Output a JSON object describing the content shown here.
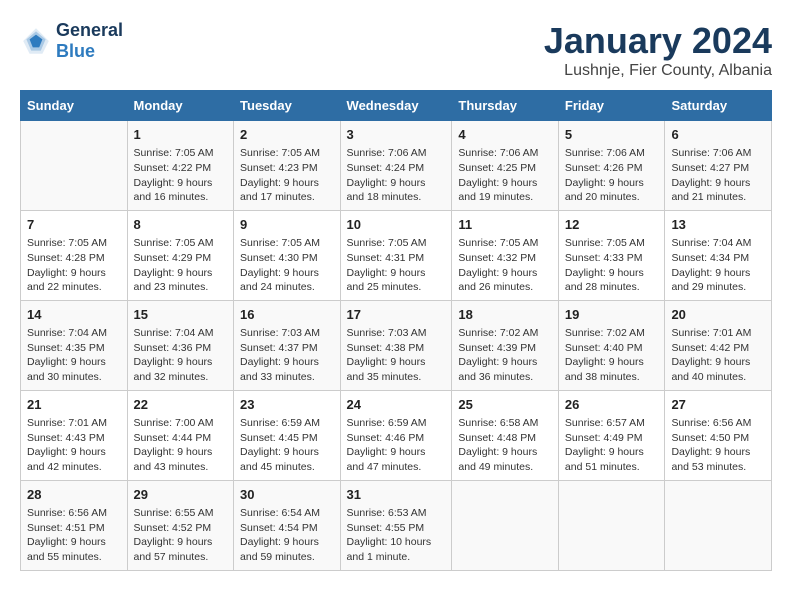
{
  "header": {
    "logo_line1": "General",
    "logo_line2": "Blue",
    "month": "January 2024",
    "location": "Lushnje, Fier County, Albania"
  },
  "columns": [
    "Sunday",
    "Monday",
    "Tuesday",
    "Wednesday",
    "Thursday",
    "Friday",
    "Saturday"
  ],
  "weeks": [
    [
      {
        "day": "",
        "info": ""
      },
      {
        "day": "1",
        "info": "Sunrise: 7:05 AM\nSunset: 4:22 PM\nDaylight: 9 hours\nand 16 minutes."
      },
      {
        "day": "2",
        "info": "Sunrise: 7:05 AM\nSunset: 4:23 PM\nDaylight: 9 hours\nand 17 minutes."
      },
      {
        "day": "3",
        "info": "Sunrise: 7:06 AM\nSunset: 4:24 PM\nDaylight: 9 hours\nand 18 minutes."
      },
      {
        "day": "4",
        "info": "Sunrise: 7:06 AM\nSunset: 4:25 PM\nDaylight: 9 hours\nand 19 minutes."
      },
      {
        "day": "5",
        "info": "Sunrise: 7:06 AM\nSunset: 4:26 PM\nDaylight: 9 hours\nand 20 minutes."
      },
      {
        "day": "6",
        "info": "Sunrise: 7:06 AM\nSunset: 4:27 PM\nDaylight: 9 hours\nand 21 minutes."
      }
    ],
    [
      {
        "day": "7",
        "info": "Sunrise: 7:05 AM\nSunset: 4:28 PM\nDaylight: 9 hours\nand 22 minutes."
      },
      {
        "day": "8",
        "info": "Sunrise: 7:05 AM\nSunset: 4:29 PM\nDaylight: 9 hours\nand 23 minutes."
      },
      {
        "day": "9",
        "info": "Sunrise: 7:05 AM\nSunset: 4:30 PM\nDaylight: 9 hours\nand 24 minutes."
      },
      {
        "day": "10",
        "info": "Sunrise: 7:05 AM\nSunset: 4:31 PM\nDaylight: 9 hours\nand 25 minutes."
      },
      {
        "day": "11",
        "info": "Sunrise: 7:05 AM\nSunset: 4:32 PM\nDaylight: 9 hours\nand 26 minutes."
      },
      {
        "day": "12",
        "info": "Sunrise: 7:05 AM\nSunset: 4:33 PM\nDaylight: 9 hours\nand 28 minutes."
      },
      {
        "day": "13",
        "info": "Sunrise: 7:04 AM\nSunset: 4:34 PM\nDaylight: 9 hours\nand 29 minutes."
      }
    ],
    [
      {
        "day": "14",
        "info": "Sunrise: 7:04 AM\nSunset: 4:35 PM\nDaylight: 9 hours\nand 30 minutes."
      },
      {
        "day": "15",
        "info": "Sunrise: 7:04 AM\nSunset: 4:36 PM\nDaylight: 9 hours\nand 32 minutes."
      },
      {
        "day": "16",
        "info": "Sunrise: 7:03 AM\nSunset: 4:37 PM\nDaylight: 9 hours\nand 33 minutes."
      },
      {
        "day": "17",
        "info": "Sunrise: 7:03 AM\nSunset: 4:38 PM\nDaylight: 9 hours\nand 35 minutes."
      },
      {
        "day": "18",
        "info": "Sunrise: 7:02 AM\nSunset: 4:39 PM\nDaylight: 9 hours\nand 36 minutes."
      },
      {
        "day": "19",
        "info": "Sunrise: 7:02 AM\nSunset: 4:40 PM\nDaylight: 9 hours\nand 38 minutes."
      },
      {
        "day": "20",
        "info": "Sunrise: 7:01 AM\nSunset: 4:42 PM\nDaylight: 9 hours\nand 40 minutes."
      }
    ],
    [
      {
        "day": "21",
        "info": "Sunrise: 7:01 AM\nSunset: 4:43 PM\nDaylight: 9 hours\nand 42 minutes."
      },
      {
        "day": "22",
        "info": "Sunrise: 7:00 AM\nSunset: 4:44 PM\nDaylight: 9 hours\nand 43 minutes."
      },
      {
        "day": "23",
        "info": "Sunrise: 6:59 AM\nSunset: 4:45 PM\nDaylight: 9 hours\nand 45 minutes."
      },
      {
        "day": "24",
        "info": "Sunrise: 6:59 AM\nSunset: 4:46 PM\nDaylight: 9 hours\nand 47 minutes."
      },
      {
        "day": "25",
        "info": "Sunrise: 6:58 AM\nSunset: 4:48 PM\nDaylight: 9 hours\nand 49 minutes."
      },
      {
        "day": "26",
        "info": "Sunrise: 6:57 AM\nSunset: 4:49 PM\nDaylight: 9 hours\nand 51 minutes."
      },
      {
        "day": "27",
        "info": "Sunrise: 6:56 AM\nSunset: 4:50 PM\nDaylight: 9 hours\nand 53 minutes."
      }
    ],
    [
      {
        "day": "28",
        "info": "Sunrise: 6:56 AM\nSunset: 4:51 PM\nDaylight: 9 hours\nand 55 minutes."
      },
      {
        "day": "29",
        "info": "Sunrise: 6:55 AM\nSunset: 4:52 PM\nDaylight: 9 hours\nand 57 minutes."
      },
      {
        "day": "30",
        "info": "Sunrise: 6:54 AM\nSunset: 4:54 PM\nDaylight: 9 hours\nand 59 minutes."
      },
      {
        "day": "31",
        "info": "Sunrise: 6:53 AM\nSunset: 4:55 PM\nDaylight: 10 hours\nand 1 minute."
      },
      {
        "day": "",
        "info": ""
      },
      {
        "day": "",
        "info": ""
      },
      {
        "day": "",
        "info": ""
      }
    ]
  ]
}
